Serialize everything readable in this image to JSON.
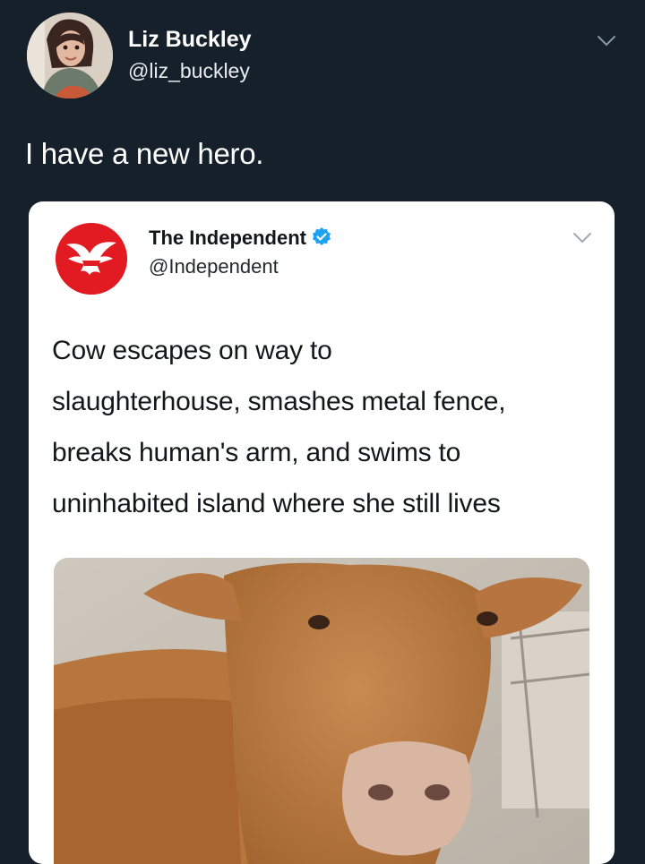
{
  "outer_tweet": {
    "author": {
      "name": "Liz Buckley",
      "handle": "@liz_buckley",
      "avatar_icon": "profile-photo"
    },
    "text": "I have a new hero.",
    "menu_icon": "chevron-down-icon"
  },
  "quoted_tweet": {
    "author": {
      "name": "The Independent",
      "handle": "@Independent",
      "logo_icon": "eagle-logo-icon",
      "verified_icon": "verified-badge-icon"
    },
    "text_lines": [
      "Cow escapes on way to",
      "slaughterhouse, smashes metal fence,",
      "breaks human's arm, and swims to",
      "uninhabited island where she still lives"
    ],
    "image": {
      "subject": "cow-photo"
    },
    "menu_icon": "chevron-down-icon"
  },
  "colors": {
    "background": "#15202b",
    "card_background": "#ffffff",
    "brand_red": "#e21a22",
    "verified_blue": "#1da1f2"
  }
}
